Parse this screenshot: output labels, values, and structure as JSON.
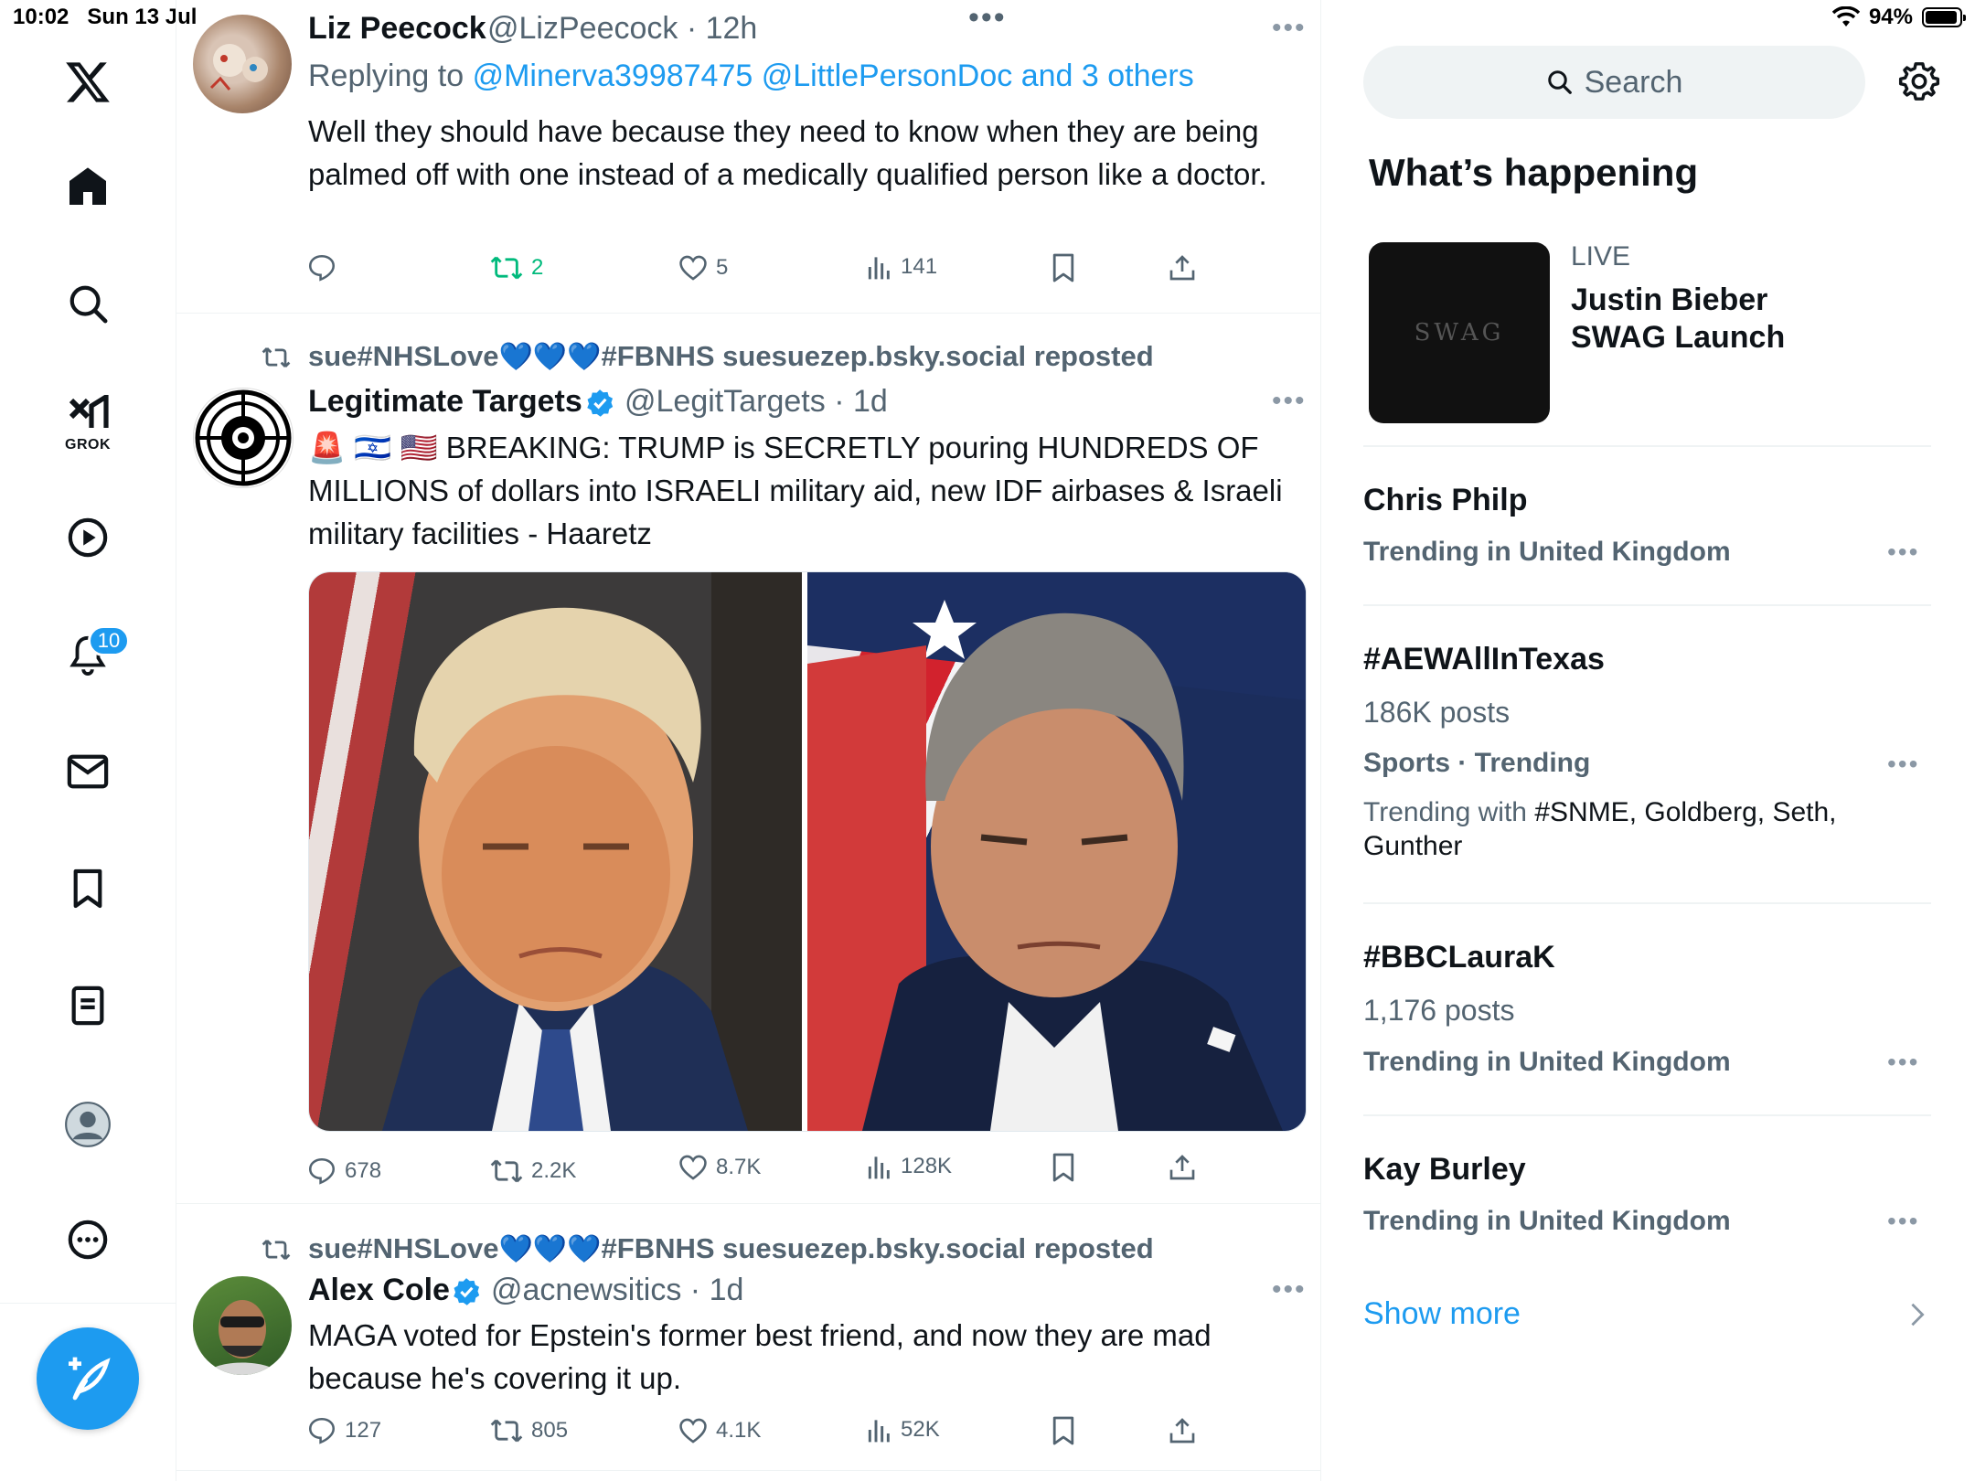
{
  "status_bar": {
    "time": "10:02",
    "date": "Sun 13 Jul",
    "battery": "94%",
    "battery_level": 0.94
  },
  "nav": {
    "items": [
      "x-logo",
      "home",
      "explore",
      "grok",
      "video",
      "notifications",
      "messages",
      "bookmarks",
      "lists",
      "profile",
      "more"
    ],
    "grok_label": "GROK",
    "notification_count": "10"
  },
  "timeline": {
    "top_more": "•••",
    "posts": [
      {
        "name": "Liz Peecock",
        "handle": "@LizPeecock",
        "time": "12h",
        "replying_prefix": "Replying to",
        "replying_to": "@Minerva39987475 @LittlePersonDoc and 3 others",
        "text": "Well they should have because they need to know when they are being palmed off with one instead of a medically qualified person like a doctor.",
        "replies": "",
        "reposts": "2",
        "likes": "5",
        "views": "141"
      },
      {
        "reposted_by": "sue#NHSLove",
        "reposted_hearts": "💙💙💙",
        "reposted_suffix": "#FBNHS suesuezep.bsky.social reposted",
        "name": "Legitimate Targets",
        "handle": "@LegitTargets",
        "time": "1d",
        "text_emojis": "🚨 🇮🇱 🇺🇸",
        "text": "BREAKING: TRUMP is SECRETLY pouring HUNDREDS OF MILLIONS of dollars into ISRAELI military aid, new IDF airbases & Israeli military facilities - Haaretz",
        "replies": "678",
        "reposts": "2.2K",
        "likes": "8.7K",
        "views": "128K"
      },
      {
        "reposted_by": "sue#NHSLove",
        "reposted_hearts": "💙💙💙",
        "reposted_suffix": "#FBNHS suesuezep.bsky.social reposted",
        "name": "Alex Cole",
        "handle": "@acnewsitics",
        "time": "1d",
        "text": "MAGA voted for Epstein's former best friend, and now they are mad because he's covering it up.",
        "replies": "127",
        "reposts": "805",
        "likes": "4.1K",
        "views": "52K"
      }
    ]
  },
  "sidebar": {
    "search_placeholder": "Search",
    "heading": "What’s happening",
    "live": {
      "tag": "LIVE",
      "title": "Justin Bieber SWAG Launch",
      "thumb_text": "SWAG"
    },
    "trends": [
      {
        "title": "Chris Philp",
        "sub": "Trending in United Kingdom"
      },
      {
        "title": "#AEWAllInTexas",
        "count": "186K posts",
        "sub": "Sports · Trending",
        "with_prefix": "Trending with",
        "with_items": "#SNME, Goldberg, Seth, Gunther"
      },
      {
        "title": "#BBCLauraK",
        "count": "1,176 posts",
        "sub": "Trending in United Kingdom"
      },
      {
        "title": "Kay Burley",
        "sub": "Trending in United Kingdom"
      }
    ],
    "trend_more": "•••",
    "show_more": "Show more"
  }
}
